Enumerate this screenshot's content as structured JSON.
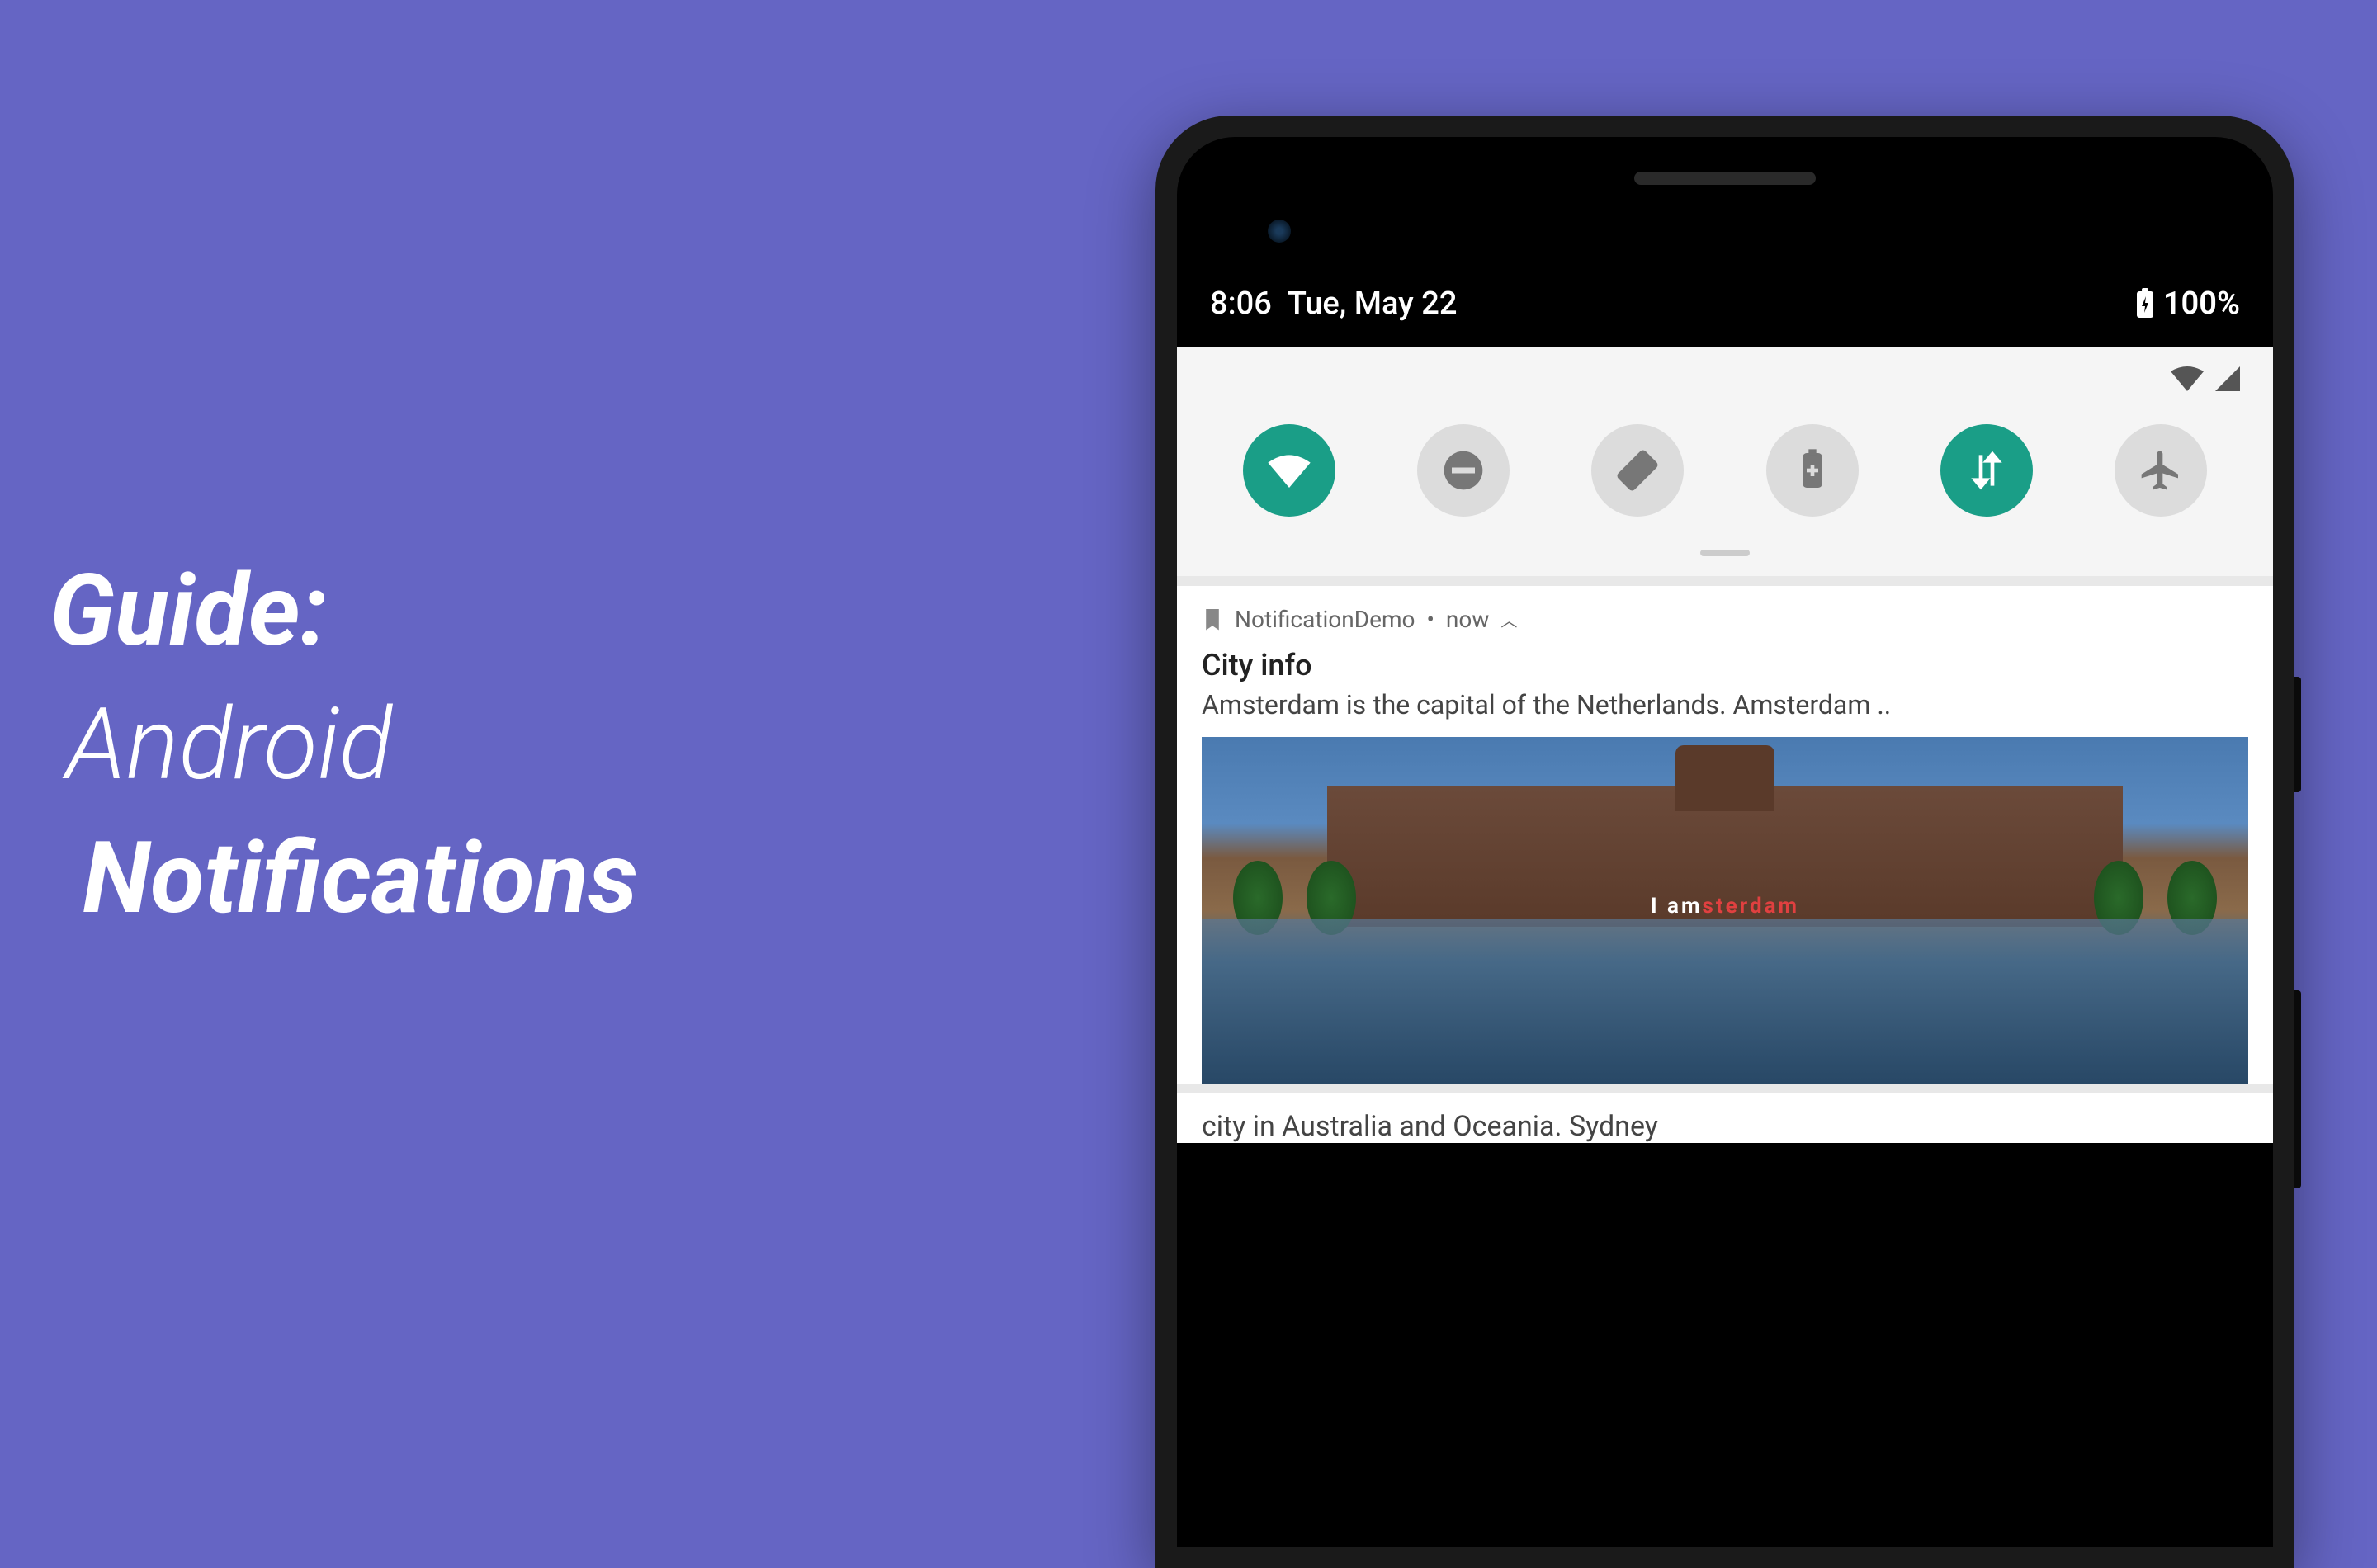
{
  "headline": {
    "line1": "Guide:",
    "line2": "Android",
    "line3": "Notifications"
  },
  "statusbar": {
    "time": "8:06",
    "date": "Tue, May 22",
    "battery": "100%"
  },
  "quick_settings": {
    "toggles": [
      {
        "name": "wifi",
        "on": true
      },
      {
        "name": "dnd",
        "on": false
      },
      {
        "name": "rotate",
        "on": false
      },
      {
        "name": "battery-saver",
        "on": false
      },
      {
        "name": "data",
        "on": true
      },
      {
        "name": "airplane",
        "on": false
      }
    ]
  },
  "notification": {
    "app_name": "NotificationDemo",
    "time": "now",
    "title": "City info",
    "text": "Amsterdam is the capital of the Netherlands. Amsterdam ..",
    "image_caption_prefix": "I am",
    "image_caption_suffix": "sterdam"
  },
  "partial_below": "city in Australia and Oceania. Sydney"
}
